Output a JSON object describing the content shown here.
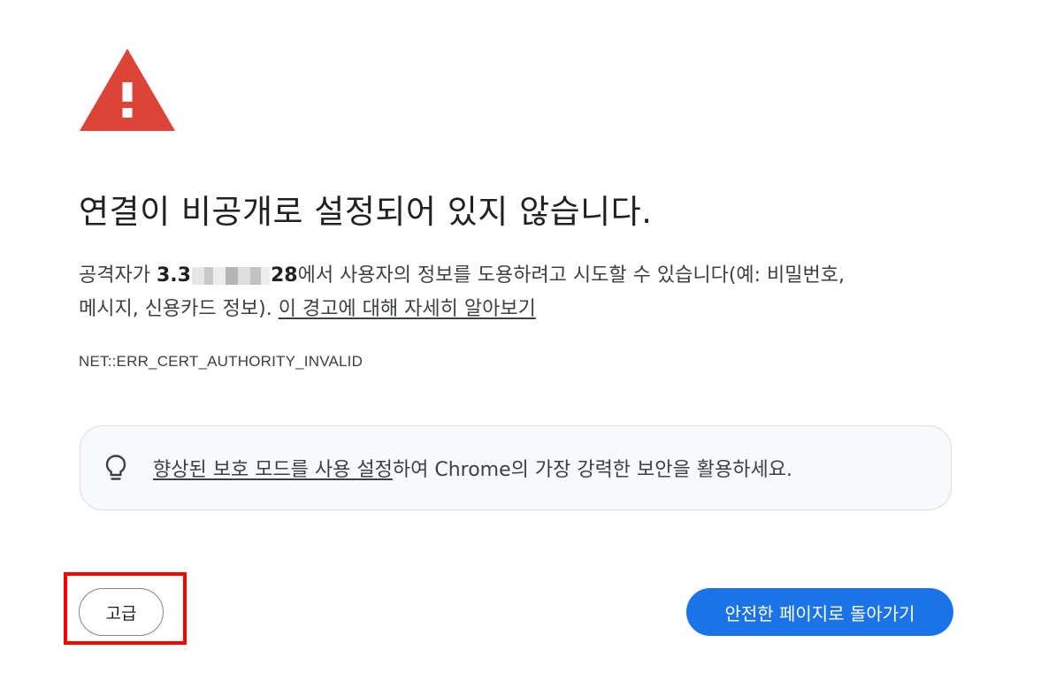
{
  "warning": {
    "icon": "warning-triangle-icon",
    "color": "#db4437"
  },
  "title": "연결이 비공개로 설정되어 있지 않습니다.",
  "description": {
    "prefix": "공격자가 ",
    "host_start": "3.3",
    "host_end": "28",
    "suffix_line1": "에서 사용자의 정보를 도용하려고 시도할 수 있습니다(예: 비밀번호,",
    "line2_text": "메시지, 신용카드 정보). ",
    "learn_more_link": "이 경고에 대해 자세히 알아보기"
  },
  "error_code": "NET::ERR_CERT_AUTHORITY_INVALID",
  "promo": {
    "icon": "lightbulb-icon",
    "link": "향상된 보호 모드를 사용 설정",
    "text": "하여 Chrome의 가장 강력한 보안을 활용하세요."
  },
  "buttons": {
    "advanced": "고급",
    "back_to_safety": "안전한 페이지로 돌아가기"
  },
  "colors": {
    "primary_button": "#1a73e8",
    "highlight": "#ff0000",
    "text": "#202124"
  }
}
